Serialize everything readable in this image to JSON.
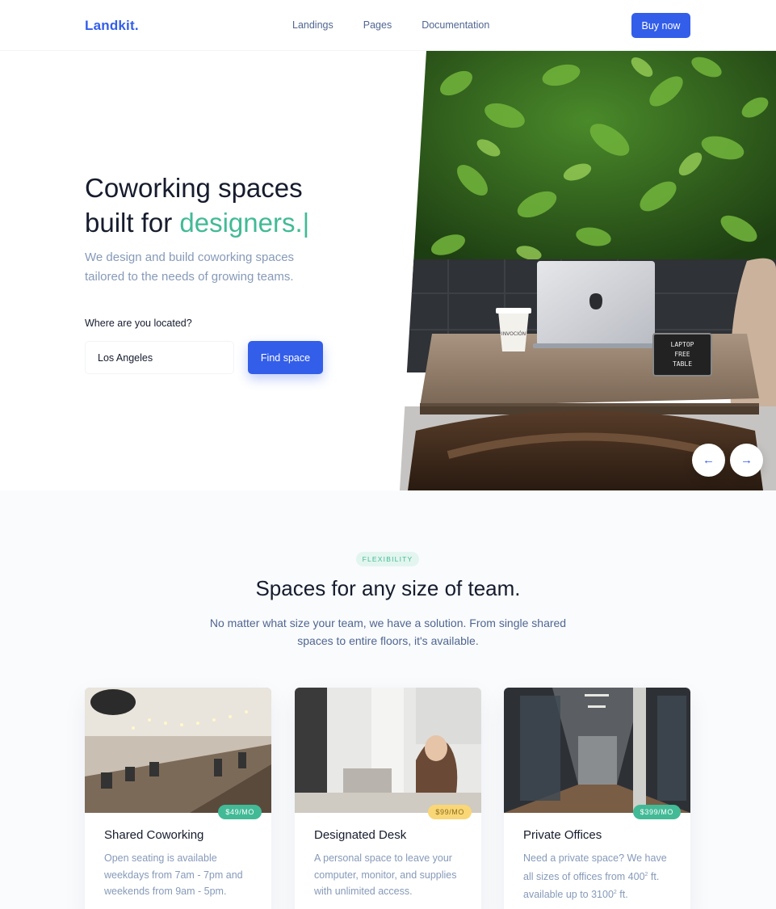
{
  "nav": {
    "brand": "Landkit.",
    "links": [
      "Landings",
      "Pages",
      "Documentation"
    ],
    "cta": "Buy now"
  },
  "hero": {
    "title_line1": "Coworking spaces",
    "title_line2_prefix": "built for ",
    "title_accent": "designers.",
    "cursor": "|",
    "subtitle": "We design and build coworking spaces tailored to the needs of growing teams.",
    "location_label": "Where are you located?",
    "location_value": "Los Angeles",
    "find_button": "Find space",
    "image_texts": {
      "cup": "INVOCIÓN",
      "sign_line1": "LAPTOP",
      "sign_line2": "FREE",
      "sign_line3": "TABLE"
    }
  },
  "section": {
    "badge": "FLEXIBILITY",
    "title": "Spaces for any size of team.",
    "subtitle": "No matter what size your team, we have a solution. From single shared spaces to entire floors, it's available.",
    "cards": [
      {
        "title": "Shared Coworking",
        "price": "$49/MO",
        "price_color": "#42ba96",
        "price_text_color": "#ffffff",
        "text": "Open seating is available weekdays from 7am - 7pm and weekends from 9am - 5pm."
      },
      {
        "title": "Designated Desk",
        "price": "$99/MO",
        "price_color": "#fad776",
        "price_text_color": "#8a6d1c",
        "text": "A personal space to leave your computer, monitor, and supplies with unlimited access."
      },
      {
        "title": "Private Offices",
        "price": "$399/MO",
        "price_color": "#42ba96",
        "price_text_color": "#ffffff",
        "text_prefix": "Need a private space? We have all sizes of offices from 400",
        "text_middle": " ft. available up to 3100",
        "text_suffix": " ft.",
        "sup": "2"
      }
    ]
  },
  "colors": {
    "primary": "#335eea",
    "success": "#42ba96",
    "muted": "#869ab8",
    "dark": "#161c2d"
  },
  "icons": {
    "prev": "arrow-left-icon",
    "next": "arrow-right-icon"
  }
}
